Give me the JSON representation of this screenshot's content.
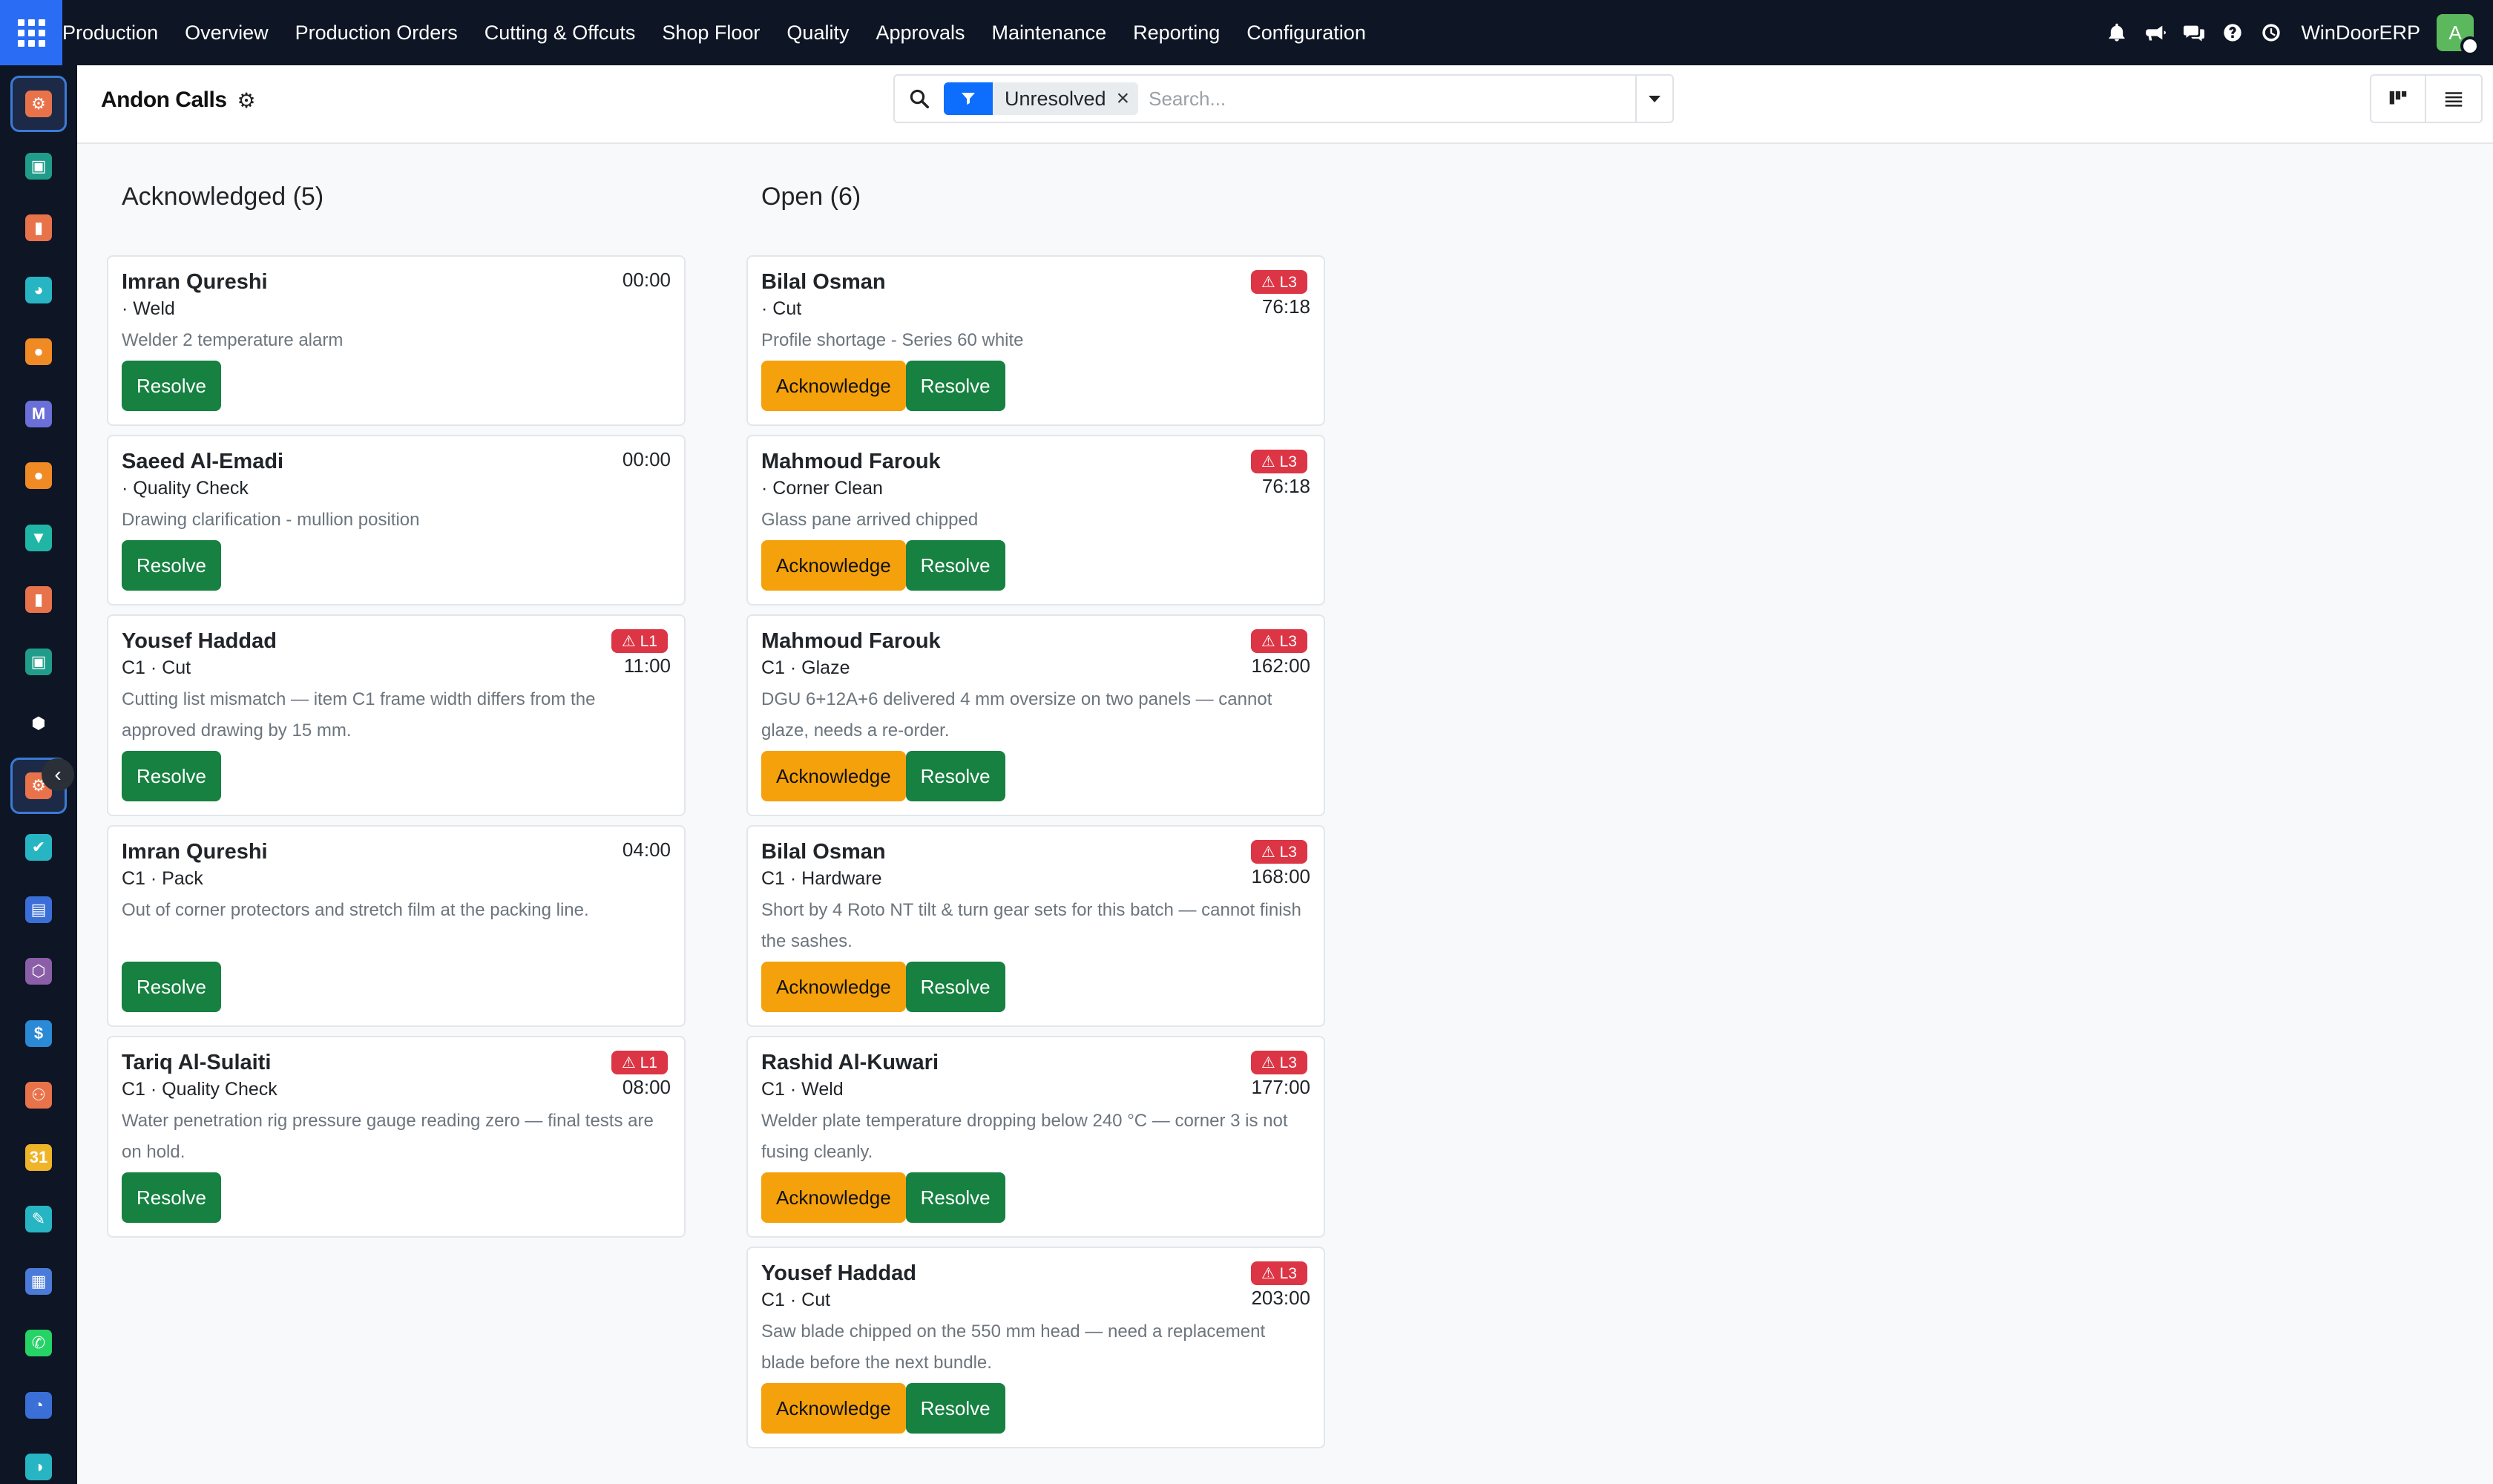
{
  "navbar": {
    "brand": "Production",
    "menu": [
      "Overview",
      "Production Orders",
      "Cutting & Offcuts",
      "Shop Floor",
      "Quality",
      "Approvals",
      "Maintenance",
      "Reporting",
      "Configuration"
    ],
    "company": "WinDoorERP",
    "avatar_initial": "A",
    "icons": [
      "bell-icon",
      "megaphone-icon",
      "chat-icon",
      "help-icon",
      "clock-icon"
    ]
  },
  "sidebar": {
    "apps": [
      {
        "icon": "manufacturing-app-icon",
        "color": "#e8734a",
        "glyph": "⚙",
        "active": true
      },
      {
        "icon": "contacts-app-icon",
        "color": "#1f9d8a",
        "glyph": "▣"
      },
      {
        "icon": "dashboard-app-icon",
        "color": "#e8734a",
        "glyph": "▮"
      },
      {
        "icon": "planning-app-icon",
        "color": "#27b5c4",
        "glyph": "◕"
      },
      {
        "icon": "discuss-app-icon",
        "color": "#f08a24",
        "glyph": "●"
      },
      {
        "icon": "email-app-icon",
        "color": "#6b6fd8",
        "glyph": "M"
      },
      {
        "icon": "livechat-app-icon",
        "color": "#f08a24",
        "glyph": "●"
      },
      {
        "icon": "documents-app-icon",
        "color": "#1fb6a6",
        "glyph": "▼"
      },
      {
        "icon": "reports-app-icon",
        "color": "#e8734a",
        "glyph": "▮"
      },
      {
        "icon": "employees-app-icon",
        "color": "#1f9d8a",
        "glyph": "▣"
      },
      {
        "icon": "inventory-app-icon",
        "color": "#ffffff",
        "glyph": "⬢"
      },
      {
        "icon": "manufacturing-app-icon",
        "color": "#e8734a",
        "glyph": "⚙",
        "active": true
      },
      {
        "icon": "quality-app-icon",
        "color": "#27b5c4",
        "glyph": "✔"
      },
      {
        "icon": "knowledge-app-icon",
        "color": "#3b6fd8",
        "glyph": "▤"
      },
      {
        "icon": "packages-app-icon",
        "color": "#8b5fa8",
        "glyph": "⬡"
      },
      {
        "icon": "invoicing-app-icon",
        "color": "#2a8ad6",
        "glyph": "$"
      },
      {
        "icon": "team-app-icon",
        "color": "#e8734a",
        "glyph": "⚇"
      },
      {
        "icon": "calendar-app-icon",
        "color": "#f0b429",
        "glyph": "31"
      },
      {
        "icon": "sign-app-icon",
        "color": "#27b5c4",
        "glyph": "✎"
      },
      {
        "icon": "apps-app-icon",
        "color": "#4a7bd8",
        "glyph": "▦"
      },
      {
        "icon": "whatsapp-app-icon",
        "color": "#25d366",
        "glyph": "✆"
      },
      {
        "icon": "timer-app-icon",
        "color": "#3b6fd8",
        "glyph": "◔"
      },
      {
        "icon": "website-app-icon",
        "color": "#27b5c4",
        "glyph": "◑"
      }
    ]
  },
  "control": {
    "title": "Andon Calls",
    "filter_label": "Unresolved",
    "search_placeholder": "Search..."
  },
  "columns": [
    {
      "title": "Acknowledged (5)",
      "cards": [
        {
          "name": "Imran Qureshi",
          "station": "· Weld",
          "description": "Welder 2 temperature alarm",
          "time": "00:00",
          "badge": "",
          "actions": [
            "Resolve"
          ]
        },
        {
          "name": "Saeed Al-Emadi",
          "station": "· Quality Check",
          "description": "Drawing clarification - mullion position",
          "time": "00:00",
          "badge": "",
          "actions": [
            "Resolve"
          ]
        },
        {
          "name": "Yousef Haddad",
          "station": "C1 · Cut",
          "description": "Cutting list mismatch — item C1 frame width differs from the approved drawing by 15 mm.",
          "time": "11:00",
          "badge": "⚠ L1",
          "actions": [
            "Resolve"
          ]
        },
        {
          "name": "Imran Qureshi",
          "station": "C1 · Pack",
          "description": "Out of corner protectors and stretch film at the packing line.",
          "time": "04:00",
          "badge": "",
          "actions": [
            "Resolve"
          ]
        },
        {
          "name": "Tariq Al-Sulaiti",
          "station": "C1 · Quality Check",
          "description": "Water penetration rig pressure gauge reading zero — final tests are on hold.",
          "time": "08:00",
          "badge": "⚠ L1",
          "actions": [
            "Resolve"
          ]
        }
      ]
    },
    {
      "title": "Open (6)",
      "cards": [
        {
          "name": "Bilal Osman",
          "station": "· Cut",
          "description": "Profile shortage - Series 60 white",
          "time": "76:18",
          "badge": "⚠ L3",
          "actions": [
            "Acknowledge",
            "Resolve"
          ]
        },
        {
          "name": "Mahmoud Farouk",
          "station": "· Corner Clean",
          "description": "Glass pane arrived chipped",
          "time": "76:18",
          "badge": "⚠ L3",
          "actions": [
            "Acknowledge",
            "Resolve"
          ]
        },
        {
          "name": "Mahmoud Farouk",
          "station": "C1 · Glaze",
          "description": "DGU 6+12A+6 delivered 4 mm oversize on two panels — cannot glaze, needs a re-order.",
          "time": "162:00",
          "badge": "⚠ L3",
          "actions": [
            "Acknowledge",
            "Resolve"
          ]
        },
        {
          "name": "Bilal Osman",
          "station": "C1 · Hardware",
          "description": "Short by 4 Roto NT tilt & turn gear sets for this batch — cannot finish the sashes.",
          "time": "168:00",
          "badge": "⚠ L3",
          "actions": [
            "Acknowledge",
            "Resolve"
          ]
        },
        {
          "name": "Rashid Al-Kuwari",
          "station": "C1 · Weld",
          "description": "Welder plate temperature dropping below 240 °C — corner 3 is not fusing cleanly.",
          "time": "177:00",
          "badge": "⚠ L3",
          "actions": [
            "Acknowledge",
            "Resolve"
          ]
        },
        {
          "name": "Yousef Haddad",
          "station": "C1 · Cut",
          "description": "Saw blade chipped on the 550 mm head — need a replacement blade before the next bundle.",
          "time": "203:00",
          "badge": "⚠ L3",
          "actions": [
            "Acknowledge",
            "Resolve"
          ]
        }
      ]
    }
  ]
}
